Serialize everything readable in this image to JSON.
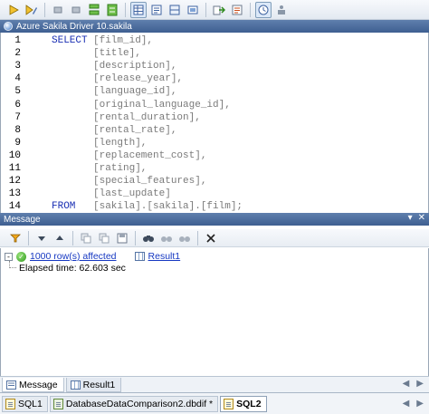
{
  "editor": {
    "title": "Azure Sakila Driver 10.sakila",
    "lines": [
      {
        "num": "1",
        "kw": "SELECT",
        "text": "[film_id],"
      },
      {
        "num": "2",
        "kw": "",
        "text": "[title],"
      },
      {
        "num": "3",
        "kw": "",
        "text": "[description],"
      },
      {
        "num": "4",
        "kw": "",
        "text": "[release_year],"
      },
      {
        "num": "5",
        "kw": "",
        "text": "[language_id],"
      },
      {
        "num": "6",
        "kw": "",
        "text": "[original_language_id],"
      },
      {
        "num": "7",
        "kw": "",
        "text": "[rental_duration],"
      },
      {
        "num": "8",
        "kw": "",
        "text": "[rental_rate],"
      },
      {
        "num": "9",
        "kw": "",
        "text": "[length],"
      },
      {
        "num": "10",
        "kw": "",
        "text": "[replacement_cost],"
      },
      {
        "num": "11",
        "kw": "",
        "text": "[rating],"
      },
      {
        "num": "12",
        "kw": "",
        "text": "[special_features],"
      },
      {
        "num": "13",
        "kw": "",
        "text": "[last_update]"
      },
      {
        "num": "14",
        "kw": "FROM",
        "text": "[sakila].[sakila].[film];"
      }
    ]
  },
  "message_panel": {
    "title": "Message",
    "result_text": "1000 row(s) affected",
    "result_link": "Result1",
    "elapsed": "Elapsed time: 62.603 sec",
    "expander": "-"
  },
  "message_tabs": [
    {
      "label": "Message"
    },
    {
      "label": "Result1"
    }
  ],
  "doc_tabs": [
    {
      "label": "SQL1"
    },
    {
      "label": "DatabaseDataComparison2.dbdif *"
    },
    {
      "label": "SQL2"
    }
  ],
  "icons": {
    "close": "✕",
    "pin": "▾",
    "nav_prev": "◀",
    "nav_next": "▶"
  },
  "colors": {
    "keyword": "#1a2fb3",
    "identifier": "#7a7a7a",
    "title_bar": "#4a6a9c",
    "link": "#1638c2"
  }
}
